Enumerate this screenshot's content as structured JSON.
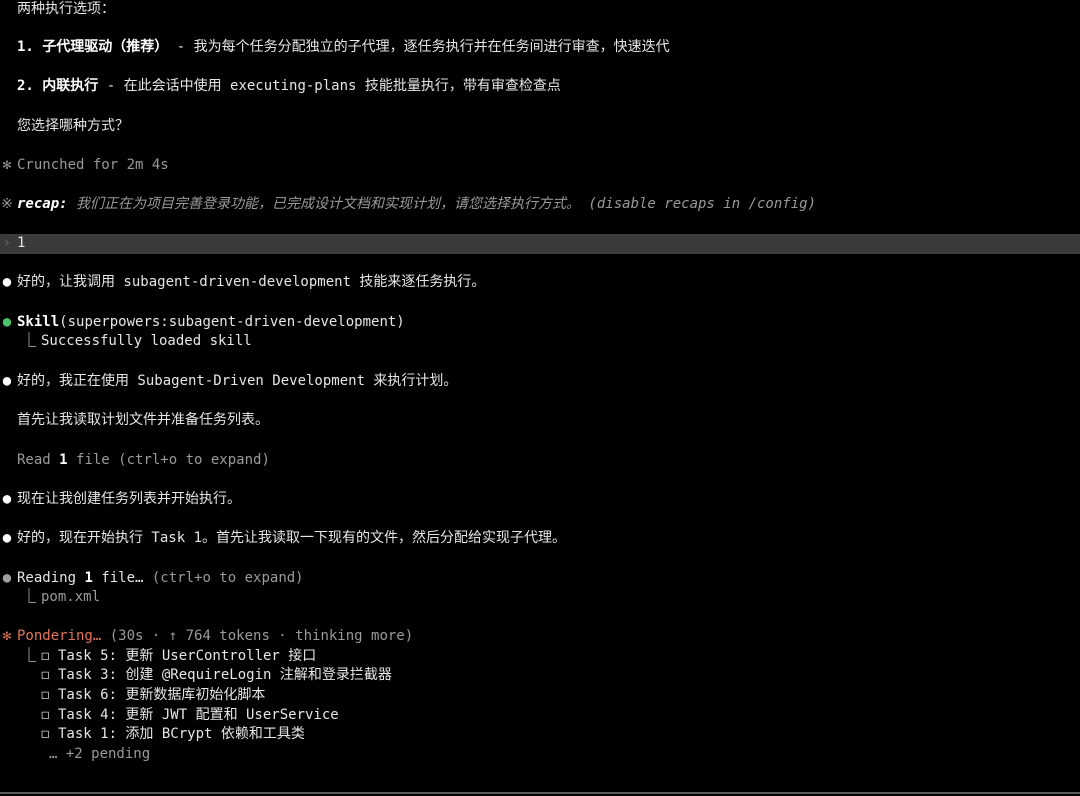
{
  "options": {
    "heading": "两种执行选项：",
    "option1": {
      "title": "1. 子代理驱动（推荐）",
      "desc": " - 我为每个任务分配独立的子代理，逐任务执行并在任务间进行审查，快速迭代"
    },
    "option2": {
      "title": "2. 内联执行",
      "desc": " - 在此会话中使用 executing-plans 技能批量执行，带有审查检查点"
    },
    "question": "您选择哪种方式？"
  },
  "crunched": {
    "glyph": "✻",
    "text": "Crunched for 2m 4s"
  },
  "recap": {
    "glyph": "※",
    "label": "recap:",
    "text": " 我们正在为项目完善登录功能，已完成设计文档和实现计划，请您选择执行方式。 (disable recaps in /config)"
  },
  "user_input": {
    "glyph": "›",
    "value": "1"
  },
  "messages": {
    "m1": "好的，让我调用 subagent-driven-development 技能来逐任务执行。",
    "skill_name": "Skill",
    "skill_arg": "(superpowers:subagent-driven-development)",
    "skill_result": "Successfully loaded skill",
    "m2": "好的，我正在使用 Subagent-Driven Development 来执行计划。",
    "m3": "首先让我读取计划文件并准备任务列表。",
    "read_prefix": "Read ",
    "read_count": "1",
    "read_suffix": " file (ctrl+o to expand)",
    "m4": "现在让我创建任务列表并开始执行。",
    "m5": "好的，现在开始执行 Task 1。首先让我读取一下现有的文件，然后分配给实现子代理。",
    "reading_prefix": "Reading ",
    "reading_count": "1",
    "reading_suffix": " file…",
    "reading_hint": " (ctrl+o to expand)",
    "reading_file": "pom.xml"
  },
  "status": {
    "glyph": "✻",
    "label": "Pondering…",
    "detail": " (30s · ↑ 764 tokens · thinking more)"
  },
  "tasks": [
    "Task 5: 更新 UserController 接口",
    "Task 3: 创建 @RequireLogin 注解和登录拦截器",
    "Task 6: 更新数据库初始化脚本",
    "Task 4: 更新 JWT 配置和 UserService",
    "Task 1: 添加 BCrypt 依赖和工具类"
  ],
  "tasks_more": "… +2 pending",
  "glyphs": {
    "bullet": "●",
    "tree": "⎿",
    "checkbox": "◻"
  },
  "colors": {
    "background": "#000000",
    "text": "#e6e6e6",
    "accent_orange": "#e2735c",
    "success_green": "#4cc36a",
    "selection_bg": "#3a3a3a"
  }
}
